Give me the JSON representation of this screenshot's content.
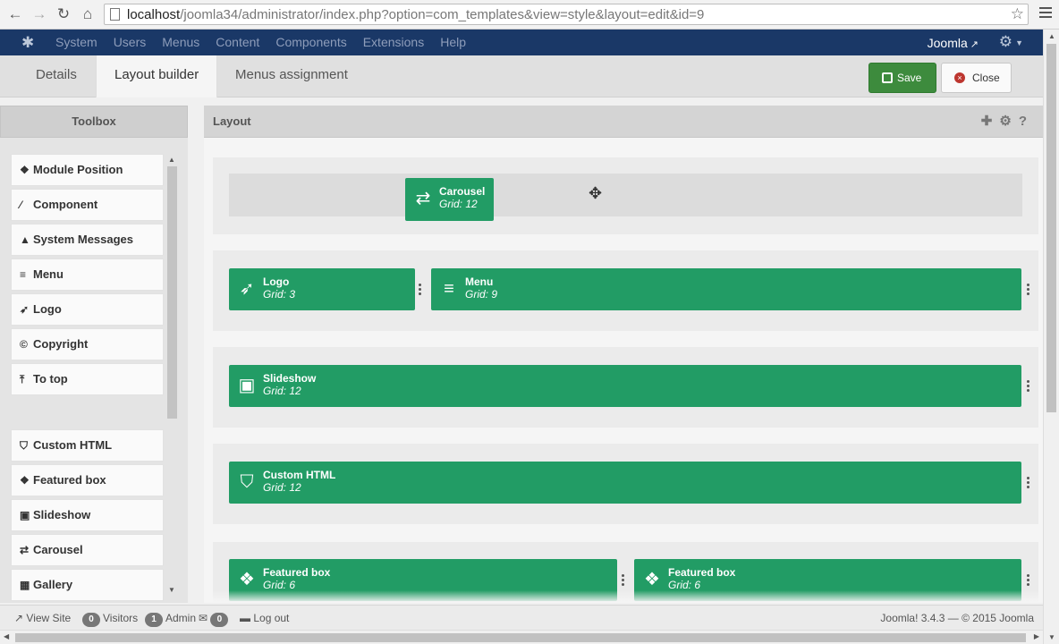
{
  "browser": {
    "url_host": "localhost",
    "url_path": "/joomla34/administrator/index.php?option=com_templates&view=style&layout=edit&id=9",
    "icons": [
      "back-icon",
      "forward-icon",
      "reload-icon",
      "home-icon",
      "star-icon",
      "menu-icon"
    ]
  },
  "topnav": {
    "items": [
      "System",
      "Users",
      "Menus",
      "Content",
      "Components",
      "Extensions",
      "Help"
    ],
    "site_link": "Joomla"
  },
  "tabs": [
    {
      "label": "Details"
    },
    {
      "label": "Layout builder"
    },
    {
      "label": "Menus assignment"
    }
  ],
  "actions": {
    "save": "Save",
    "close": "Close"
  },
  "toolbox": {
    "title": "Toolbox",
    "items": [
      {
        "label": "Module Position",
        "icon": "cubes-icon"
      },
      {
        "label": "Component",
        "icon": "magic-icon"
      },
      {
        "label": "System Messages",
        "icon": "warning-icon"
      },
      {
        "label": "Menu",
        "icon": "bars-icon"
      },
      {
        "label": "Logo",
        "icon": "rocket-icon"
      },
      {
        "label": "Copyright",
        "icon": "copyright-icon"
      },
      {
        "label": "To top",
        "icon": "upload-icon"
      },
      {
        "label": "Custom HTML",
        "icon": "html5-icon"
      },
      {
        "label": "Featured box",
        "icon": "dropbox-icon"
      },
      {
        "label": "Slideshow",
        "icon": "slideshare-icon"
      },
      {
        "label": "Carousel",
        "icon": "exchange-icon"
      },
      {
        "label": "Gallery",
        "icon": "th-large-icon"
      }
    ]
  },
  "layout": {
    "title": "Layout",
    "header_icons": [
      "plus-icon",
      "gear-icon",
      "question-icon"
    ],
    "rows": [
      {
        "blocks": [
          {
            "name": "Carousel",
            "grid": "Grid: 12",
            "icon": "exchange-icon"
          }
        ]
      },
      {
        "blocks": [
          {
            "name": "Logo",
            "grid": "Grid: 3",
            "icon": "rocket-icon"
          },
          {
            "name": "Menu",
            "grid": "Grid: 9",
            "icon": "bars-icon"
          }
        ]
      },
      {
        "blocks": [
          {
            "name": "Slideshow",
            "grid": "Grid: 12",
            "icon": "slideshare-icon"
          }
        ]
      },
      {
        "blocks": [
          {
            "name": "Custom HTML",
            "grid": "Grid: 12",
            "icon": "html5-icon"
          }
        ]
      },
      {
        "blocks": [
          {
            "name": "Featured box",
            "grid": "Grid: 6",
            "icon": "dropbox-icon"
          },
          {
            "name": "Featured box",
            "grid": "Grid: 6",
            "icon": "dropbox-icon"
          }
        ]
      }
    ]
  },
  "status": {
    "view_site": "View Site",
    "visitors_count": "0",
    "visitors_label": "Visitors",
    "admin_count": "1",
    "admin_label": "Admin",
    "messages_count": "0",
    "logout": "Log out",
    "footer": "Joomla! 3.4.3 — © 2015 Joomla"
  },
  "colors": {
    "nav_bg": "#1a3867",
    "block_green": "#229c65",
    "save_green": "#3d8b3d",
    "close_red": "#bd362f"
  }
}
